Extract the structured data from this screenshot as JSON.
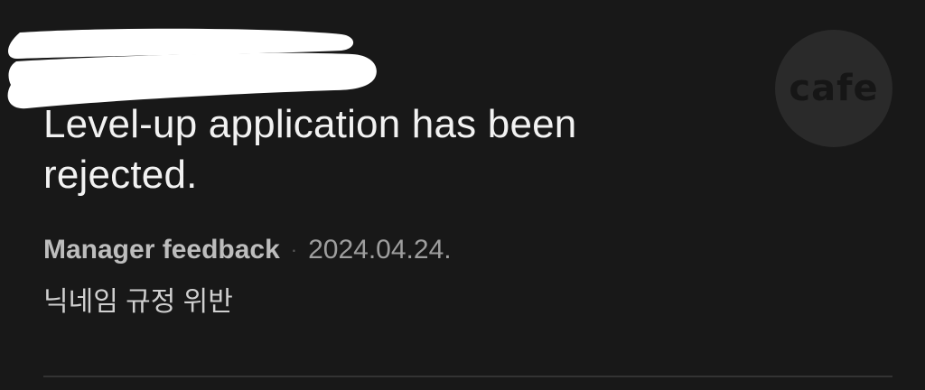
{
  "notification": {
    "title": "Level-up application has been rejected.",
    "sender": "Manager feedback",
    "separator": "·",
    "date": "2024.04.24.",
    "reason": "닉네임 규정 위반",
    "avatar_label": "cafe"
  },
  "colors": {
    "background": "#181818",
    "redaction": "#ffffff",
    "title_text": "#f2f2f2",
    "avatar_bg": "#2a2a2a"
  }
}
